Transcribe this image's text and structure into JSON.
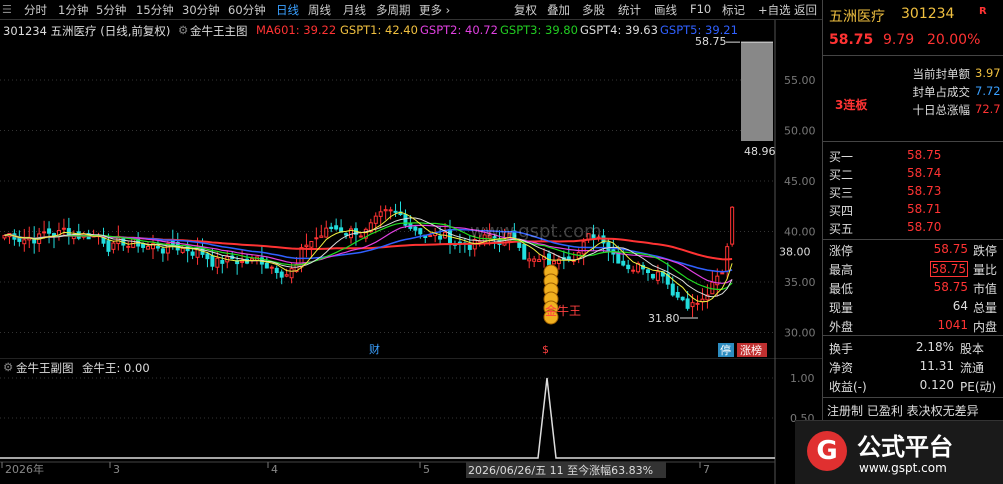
{
  "toolbar": {
    "items": [
      "分时",
      "1分钟",
      "5分钟",
      "15分钟",
      "30分钟",
      "60分钟",
      "日线",
      "周线",
      "月线",
      "多周期",
      "更多 ›",
      "复权",
      "叠加",
      "多股",
      "统计",
      "画线",
      "F10",
      "标记",
      "+自选",
      "返回"
    ],
    "active_index": 6
  },
  "info": {
    "stock": "301234 五洲医疗 (日线,前复权)",
    "indicator_name": "金牛王主图",
    "ma601": "MA601: 39.22",
    "gspt1": "GSPT1: 42.40",
    "gspt2": "GSPT2: 40.72",
    "gspt3": "GSPT3: 39.80",
    "gspt4": "GSPT4: 39.63",
    "gspt5": "GSPT5: 39.21"
  },
  "price_axis": [
    "55.00",
    "50.00",
    "45.00",
    "40.00",
    "35.00",
    "30.00"
  ],
  "current_price_label": "38.00",
  "annotations": {
    "high_label": "58.75",
    "low_label": "31.80",
    "gap_low": "48.96",
    "signal_text": "金牛王",
    "marker_cai": "财",
    "marker_dollar": "$",
    "marker_ting": "停",
    "marker_zhangbang": "涨榜",
    "watermark": "www.gspt.com"
  },
  "sub_chart": {
    "title": "金牛王副图",
    "value": "金牛王: 0.00",
    "axis": [
      "1.00",
      "0.50"
    ]
  },
  "time_axis": {
    "labels": [
      "2026年",
      "3",
      "4",
      "5",
      "7"
    ],
    "tooltip": "2026/06/26/五  11  至今涨幅63.83%"
  },
  "colors": {
    "up": "#ff3333",
    "down": "#22dddd",
    "ma601": "#ff3333",
    "gspt1": "#f0f040",
    "gspt2": "#e040e0",
    "gspt3": "#22dd22",
    "gspt4": "#dddddd",
    "gspt5": "#3060ff"
  },
  "right_panel": {
    "name": "五洲医疗",
    "code": "301234",
    "badge": "R",
    "price": "58.75",
    "change": "9.79",
    "pct": "20.00%",
    "limit_rows": [
      {
        "label": "当前封单额",
        "value": "3.97"
      },
      {
        "label": "封单占成交",
        "value": "7.72"
      },
      {
        "label": "十日总涨幅",
        "value": "72.7"
      }
    ],
    "lianban": "3连板",
    "book": [
      {
        "label": "买一",
        "price": "58.75"
      },
      {
        "label": "买二",
        "price": "58.74"
      },
      {
        "label": "买三",
        "price": "58.73"
      },
      {
        "label": "买四",
        "price": "58.71"
      },
      {
        "label": "买五",
        "price": "58.70"
      }
    ],
    "stats": [
      {
        "label": "涨停",
        "value": "58.75",
        "right": "跌停",
        "color": "#ff3333"
      },
      {
        "label": "最高",
        "value": "58.75",
        "right": "量比",
        "color": "#ff3333"
      },
      {
        "label": "最低",
        "value": "58.75",
        "right": "市值",
        "color": "#ff3333"
      },
      {
        "label": "现量",
        "value": "64",
        "right": "总量",
        "color": "#dddddd"
      },
      {
        "label": "外盘",
        "value": "1041",
        "right": "内盘",
        "color": "#ff3333"
      }
    ],
    "stats2": [
      {
        "label": "换手",
        "value": "2.18%",
        "right": "股本"
      },
      {
        "label": "净资",
        "value": "11.31",
        "right": "流通"
      },
      {
        "label": "收益(-)",
        "value": "0.120",
        "right": "PE(动)"
      }
    ],
    "tags": "注册制 已盈利 表决权无差异"
  },
  "logo": {
    "title": "公式平台",
    "url": "www.gspt.com"
  }
}
